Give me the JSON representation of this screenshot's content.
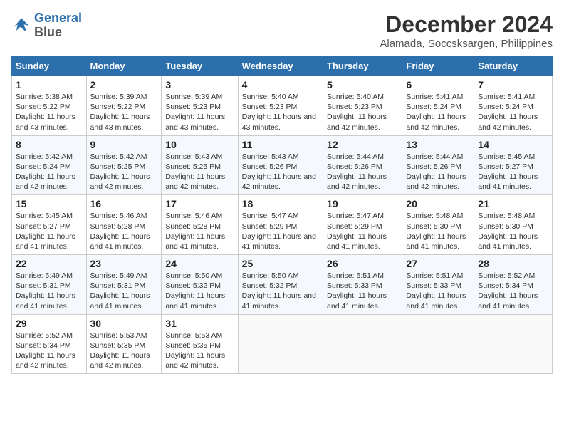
{
  "logo": {
    "line1": "General",
    "line2": "Blue"
  },
  "title": "December 2024",
  "subtitle": "Alamada, Soccsksargen, Philippines",
  "weekdays": [
    "Sunday",
    "Monday",
    "Tuesday",
    "Wednesday",
    "Thursday",
    "Friday",
    "Saturday"
  ],
  "weeks": [
    [
      {
        "day": "1",
        "sunrise": "Sunrise: 5:38 AM",
        "sunset": "Sunset: 5:22 PM",
        "daylight": "Daylight: 11 hours and 43 minutes."
      },
      {
        "day": "2",
        "sunrise": "Sunrise: 5:39 AM",
        "sunset": "Sunset: 5:22 PM",
        "daylight": "Daylight: 11 hours and 43 minutes."
      },
      {
        "day": "3",
        "sunrise": "Sunrise: 5:39 AM",
        "sunset": "Sunset: 5:23 PM",
        "daylight": "Daylight: 11 hours and 43 minutes."
      },
      {
        "day": "4",
        "sunrise": "Sunrise: 5:40 AM",
        "sunset": "Sunset: 5:23 PM",
        "daylight": "Daylight: 11 hours and 43 minutes."
      },
      {
        "day": "5",
        "sunrise": "Sunrise: 5:40 AM",
        "sunset": "Sunset: 5:23 PM",
        "daylight": "Daylight: 11 hours and 42 minutes."
      },
      {
        "day": "6",
        "sunrise": "Sunrise: 5:41 AM",
        "sunset": "Sunset: 5:24 PM",
        "daylight": "Daylight: 11 hours and 42 minutes."
      },
      {
        "day": "7",
        "sunrise": "Sunrise: 5:41 AM",
        "sunset": "Sunset: 5:24 PM",
        "daylight": "Daylight: 11 hours and 42 minutes."
      }
    ],
    [
      {
        "day": "8",
        "sunrise": "Sunrise: 5:42 AM",
        "sunset": "Sunset: 5:24 PM",
        "daylight": "Daylight: 11 hours and 42 minutes."
      },
      {
        "day": "9",
        "sunrise": "Sunrise: 5:42 AM",
        "sunset": "Sunset: 5:25 PM",
        "daylight": "Daylight: 11 hours and 42 minutes."
      },
      {
        "day": "10",
        "sunrise": "Sunrise: 5:43 AM",
        "sunset": "Sunset: 5:25 PM",
        "daylight": "Daylight: 11 hours and 42 minutes."
      },
      {
        "day": "11",
        "sunrise": "Sunrise: 5:43 AM",
        "sunset": "Sunset: 5:26 PM",
        "daylight": "Daylight: 11 hours and 42 minutes."
      },
      {
        "day": "12",
        "sunrise": "Sunrise: 5:44 AM",
        "sunset": "Sunset: 5:26 PM",
        "daylight": "Daylight: 11 hours and 42 minutes."
      },
      {
        "day": "13",
        "sunrise": "Sunrise: 5:44 AM",
        "sunset": "Sunset: 5:26 PM",
        "daylight": "Daylight: 11 hours and 42 minutes."
      },
      {
        "day": "14",
        "sunrise": "Sunrise: 5:45 AM",
        "sunset": "Sunset: 5:27 PM",
        "daylight": "Daylight: 11 hours and 41 minutes."
      }
    ],
    [
      {
        "day": "15",
        "sunrise": "Sunrise: 5:45 AM",
        "sunset": "Sunset: 5:27 PM",
        "daylight": "Daylight: 11 hours and 41 minutes."
      },
      {
        "day": "16",
        "sunrise": "Sunrise: 5:46 AM",
        "sunset": "Sunset: 5:28 PM",
        "daylight": "Daylight: 11 hours and 41 minutes."
      },
      {
        "day": "17",
        "sunrise": "Sunrise: 5:46 AM",
        "sunset": "Sunset: 5:28 PM",
        "daylight": "Daylight: 11 hours and 41 minutes."
      },
      {
        "day": "18",
        "sunrise": "Sunrise: 5:47 AM",
        "sunset": "Sunset: 5:29 PM",
        "daylight": "Daylight: 11 hours and 41 minutes."
      },
      {
        "day": "19",
        "sunrise": "Sunrise: 5:47 AM",
        "sunset": "Sunset: 5:29 PM",
        "daylight": "Daylight: 11 hours and 41 minutes."
      },
      {
        "day": "20",
        "sunrise": "Sunrise: 5:48 AM",
        "sunset": "Sunset: 5:30 PM",
        "daylight": "Daylight: 11 hours and 41 minutes."
      },
      {
        "day": "21",
        "sunrise": "Sunrise: 5:48 AM",
        "sunset": "Sunset: 5:30 PM",
        "daylight": "Daylight: 11 hours and 41 minutes."
      }
    ],
    [
      {
        "day": "22",
        "sunrise": "Sunrise: 5:49 AM",
        "sunset": "Sunset: 5:31 PM",
        "daylight": "Daylight: 11 hours and 41 minutes."
      },
      {
        "day": "23",
        "sunrise": "Sunrise: 5:49 AM",
        "sunset": "Sunset: 5:31 PM",
        "daylight": "Daylight: 11 hours and 41 minutes."
      },
      {
        "day": "24",
        "sunrise": "Sunrise: 5:50 AM",
        "sunset": "Sunset: 5:32 PM",
        "daylight": "Daylight: 11 hours and 41 minutes."
      },
      {
        "day": "25",
        "sunrise": "Sunrise: 5:50 AM",
        "sunset": "Sunset: 5:32 PM",
        "daylight": "Daylight: 11 hours and 41 minutes."
      },
      {
        "day": "26",
        "sunrise": "Sunrise: 5:51 AM",
        "sunset": "Sunset: 5:33 PM",
        "daylight": "Daylight: 11 hours and 41 minutes."
      },
      {
        "day": "27",
        "sunrise": "Sunrise: 5:51 AM",
        "sunset": "Sunset: 5:33 PM",
        "daylight": "Daylight: 11 hours and 41 minutes."
      },
      {
        "day": "28",
        "sunrise": "Sunrise: 5:52 AM",
        "sunset": "Sunset: 5:34 PM",
        "daylight": "Daylight: 11 hours and 41 minutes."
      }
    ],
    [
      {
        "day": "29",
        "sunrise": "Sunrise: 5:52 AM",
        "sunset": "Sunset: 5:34 PM",
        "daylight": "Daylight: 11 hours and 42 minutes."
      },
      {
        "day": "30",
        "sunrise": "Sunrise: 5:53 AM",
        "sunset": "Sunset: 5:35 PM",
        "daylight": "Daylight: 11 hours and 42 minutes."
      },
      {
        "day": "31",
        "sunrise": "Sunrise: 5:53 AM",
        "sunset": "Sunset: 5:35 PM",
        "daylight": "Daylight: 11 hours and 42 minutes."
      },
      null,
      null,
      null,
      null
    ]
  ]
}
